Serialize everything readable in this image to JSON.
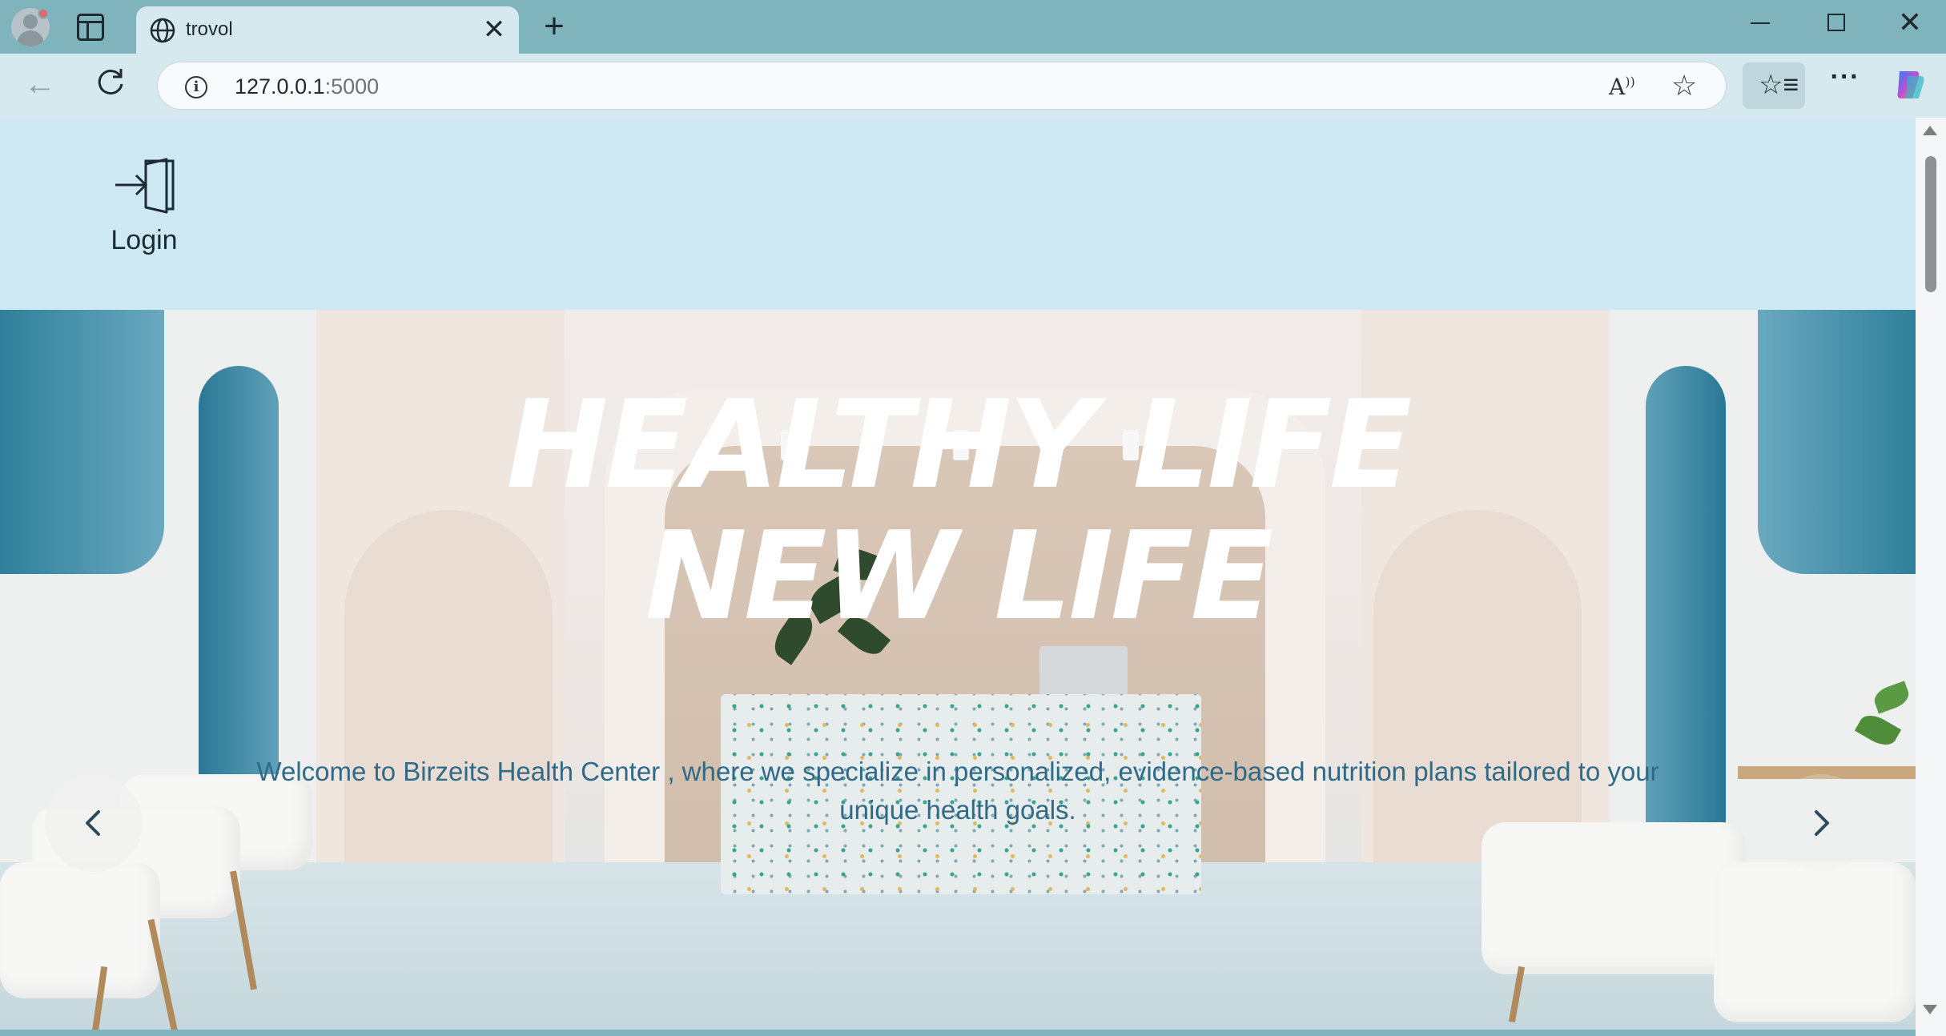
{
  "browser": {
    "tab": {
      "title": "trovol"
    },
    "address_bar": {
      "url_host": "127.0.0.1",
      "url_port": ":5000"
    }
  },
  "site": {
    "header": {
      "login_label": "Login"
    },
    "hero": {
      "title_line1": "HEALTHY LIFE",
      "title_line2": "NEW LIFE",
      "subtitle": "Welcome to Birzeits Health Center , where we specialize in personalized, evidence-based nutrition plans tailored to your unique health goals."
    }
  },
  "colors": {
    "browser_frame": "#80b4bd",
    "toolbar": "#d5e9ee",
    "header_bg": "#cfe9f4",
    "hero_title": "#ffffff",
    "hero_subtitle": "#2f6a88"
  },
  "icons": [
    "profile-icon",
    "tab-actions-icon",
    "globe-icon",
    "close-icon",
    "plus-icon",
    "minimize-icon",
    "maximize-icon",
    "back-arrow-icon",
    "reload-icon",
    "info-icon",
    "read-aloud-icon",
    "star-icon",
    "favorites-icon",
    "more-icon",
    "copilot-icon",
    "login-door-icon",
    "chevron-left-icon",
    "chevron-right-icon"
  ]
}
